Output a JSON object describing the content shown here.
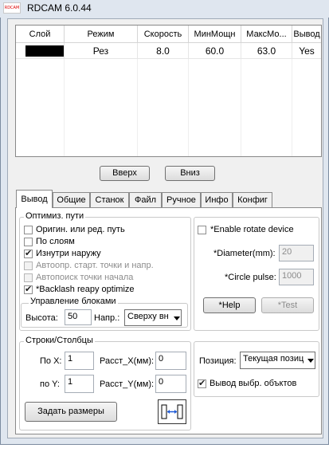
{
  "window": {
    "title": "RDCAM 6.0.44",
    "logo_text": "RDCAM"
  },
  "layers_table": {
    "headers": [
      "Слой",
      "Режим",
      "Скорость",
      "МинМощн",
      "МаксМо...",
      "Вывод"
    ],
    "rows": [
      {
        "layer_color": "#000000",
        "mode": "Рез",
        "speed": "8.0",
        "min_power": "60.0",
        "max_power": "63.0",
        "output": "Yes"
      }
    ]
  },
  "buttons": {
    "up": "Вверх",
    "down": "Вниз"
  },
  "tabs": [
    "Вывод",
    "Общие",
    "Станок",
    "Файл",
    "Ручное",
    "Инфо",
    "Конфиг"
  ],
  "output_tab": {
    "path_opt": {
      "title": "Оптимиз. пути",
      "options": [
        {
          "label": "Оригин. или ред. путь",
          "checked": false,
          "enabled": true
        },
        {
          "label": "По слоям",
          "checked": false,
          "enabled": true
        },
        {
          "label": "Изнутри наружу",
          "checked": true,
          "enabled": true
        },
        {
          "label": "Автоопр. старт. точки и напр.",
          "checked": false,
          "enabled": false
        },
        {
          "label": "Автопоиск точки начала",
          "checked": false,
          "enabled": false
        },
        {
          "label": "*Backlash reapy optimize",
          "checked": true,
          "enabled": true
        }
      ],
      "block": {
        "title": "Управление блоками",
        "height_label": "Высота:",
        "height_value": "50",
        "dir_label": "Напр.:",
        "dir_value": "Сверху вн"
      }
    },
    "rotate": {
      "enable_label": "*Enable rotate device",
      "diameter_label": "*Diameter(mm):",
      "diameter_value": "20",
      "pulse_label": "*Circle pulse:",
      "pulse_value": "1000",
      "help_button": "*Help",
      "test_button": "*Test"
    },
    "array": {
      "title": "Строки/Столбцы",
      "x_label": "По X:",
      "x_value": "1",
      "x_dist_label": "Расст_X(мм):",
      "x_dist_value": "0",
      "y_label": "по Y:",
      "y_value": "1",
      "y_dist_label": "Расст_Y(мм):",
      "y_dist_value": "0",
      "set_size_button": "Задать размеры"
    },
    "position": {
      "label": "Позиция:",
      "value": "Текущая позиц"
    },
    "output_selected": {
      "label": "Вывод выбр. объктов",
      "checked": true
    }
  }
}
